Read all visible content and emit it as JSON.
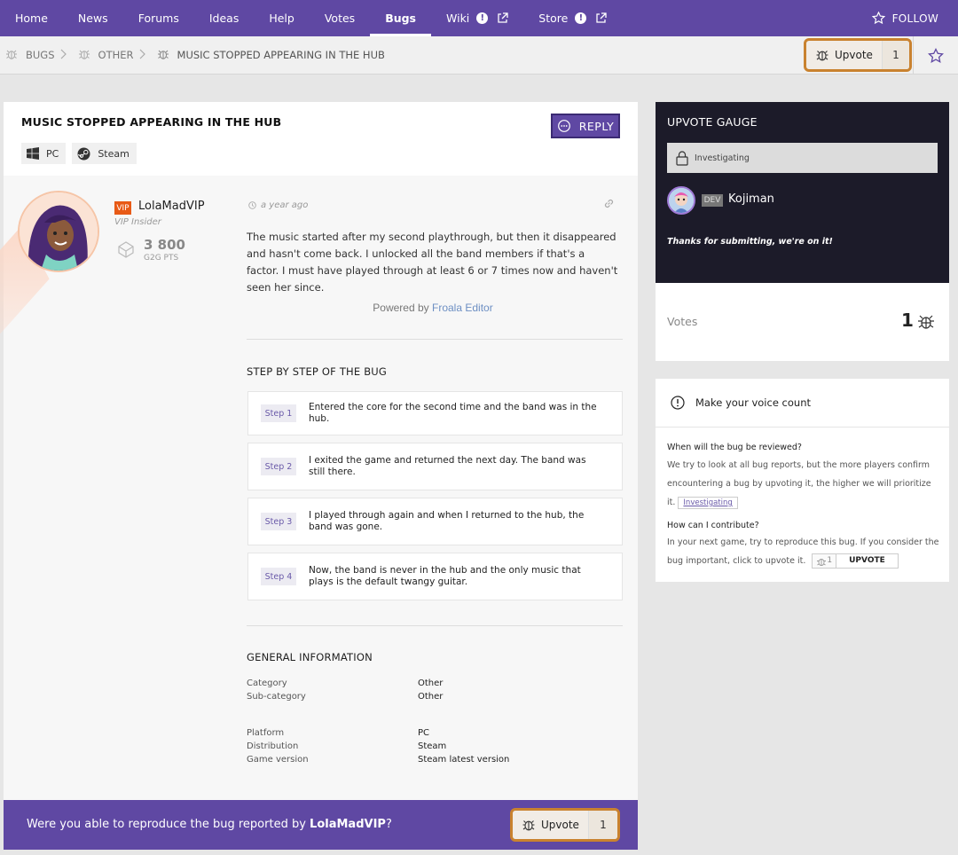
{
  "nav": {
    "items": [
      {
        "label": "Home"
      },
      {
        "label": "News"
      },
      {
        "label": "Forums"
      },
      {
        "label": "Ideas"
      },
      {
        "label": "Help"
      },
      {
        "label": "Votes"
      },
      {
        "label": "Bugs"
      },
      {
        "label": "Wiki"
      },
      {
        "label": "Store"
      }
    ],
    "follow_label": "FOLLOW",
    "badge": "!"
  },
  "breadcrumb": {
    "items": [
      "BUGS",
      "OTHER",
      "MUSIC STOPPED APPEARING IN THE HUB"
    ]
  },
  "upvote": {
    "label": "Upvote",
    "count": "1"
  },
  "post": {
    "title": "MUSIC STOPPED APPEARING IN THE HUB",
    "reply_label": "REPLY",
    "tags": [
      "PC",
      "Steam"
    ],
    "author": {
      "vip_badge": "VIP",
      "name": "LolaMadVIP",
      "title": "VIP Insider",
      "points": "3 800",
      "points_label": "G2G PTS"
    },
    "time": "a year ago",
    "body": "The music started after my second playthrough, but then it disappeared and hasn't come back. I unlocked all the band members if that's a factor. I must have played through at least 6 or 7 times now and haven't seen her since.",
    "powered_prefix": "Powered by",
    "powered_link": "Froala Editor"
  },
  "steps": {
    "title": "STEP BY STEP OF THE BUG",
    "items": [
      {
        "badge": "Step 1",
        "text": "Entered the core for the second time and the band was in the hub."
      },
      {
        "badge": "Step 2",
        "text": "I exited the game and returned the next day. The band was still there."
      },
      {
        "badge": "Step 3",
        "text": "I played through again and when I returned to the hub, the band was gone."
      },
      {
        "badge": "Step 4",
        "text": "Now, the band is never in the hub and the only music that plays is the default twangy guitar."
      }
    ]
  },
  "general": {
    "title": "GENERAL INFORMATION",
    "rows": [
      {
        "label": "Category",
        "value": "Other"
      },
      {
        "label": "Sub-category",
        "value": "Other"
      },
      {
        "label": "Platform",
        "value": "PC"
      },
      {
        "label": "Distribution",
        "value": "Steam"
      },
      {
        "label": "Game version",
        "value": "Steam latest version"
      }
    ]
  },
  "footer": {
    "prefix": "Were you able to reproduce the bug reported by ",
    "user": "LolaMadVIP",
    "suffix": "?"
  },
  "gauge": {
    "title": "UPVOTE GAUGE",
    "status": "Investigating",
    "dev_badge": "DEV",
    "dev_name": "Kojiman",
    "dev_message": "Thanks for submitting, we're on it!",
    "votes_label": "Votes",
    "votes_count": "1"
  },
  "voice": {
    "title": "Make your voice count",
    "q1": "When will the bug be reviewed?",
    "a1": "We try to look at all bug reports, but the more players confirm encountering a bug by upvoting it, the higher we will prioritize it.",
    "a1_chip": "Investigating",
    "q2": "How can I contribute?",
    "a2": "In your next game, try to reproduce this bug. If you consider the bug important, click to upvote it.",
    "mini_count": "1",
    "mini_label": "UPVOTE"
  },
  "colors": {
    "brand_purple": "#5f48a3",
    "upvote_outline": "#c9822f",
    "gauge_bg": "#1c1b29",
    "vip_orange": "#e85a16"
  }
}
